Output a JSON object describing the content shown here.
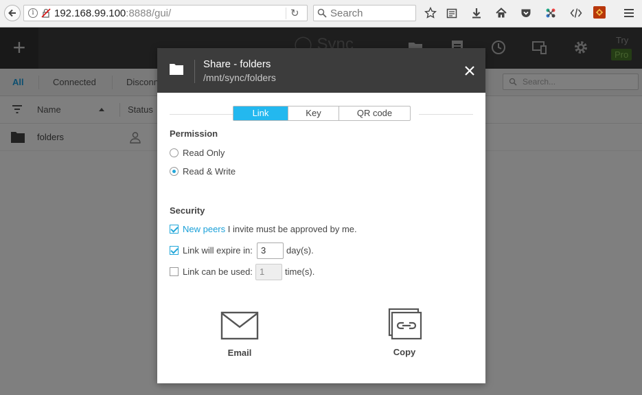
{
  "browser": {
    "url_host": "192.168.99.100",
    "url_rest": ":8888/gui/",
    "search_placeholder": "Search"
  },
  "app": {
    "logo_text": "Sync",
    "try_label": "Try",
    "pro_label": "Pro",
    "tabs": [
      "All",
      "Connected",
      "Disconn"
    ],
    "search_placeholder": "Search...",
    "columns": {
      "name": "Name",
      "status": "Status"
    },
    "rows": [
      {
        "name": "folders"
      }
    ]
  },
  "modal": {
    "title": "Share - folders",
    "path": "/mnt/sync/folders",
    "segments": [
      "Link",
      "Key",
      "QR code"
    ],
    "active_segment": "Link",
    "permission": {
      "heading": "Permission",
      "options": [
        "Read Only",
        "Read & Write"
      ],
      "selected": "Read & Write"
    },
    "security": {
      "heading": "Security",
      "new_peers_link": "New peers",
      "new_peers_text": "I invite must be approved by me.",
      "expire_label": "Link will expire in:",
      "expire_value": "3",
      "expire_unit": "day(s).",
      "uses_label": "Link can be used:",
      "uses_value": "1",
      "uses_unit": "time(s)."
    },
    "actions": {
      "email": "Email",
      "copy": "Copy"
    }
  },
  "colors": {
    "accent": "#23b8ef",
    "header": "#3c3c3c",
    "pro_badge": "#4a7a2b"
  }
}
